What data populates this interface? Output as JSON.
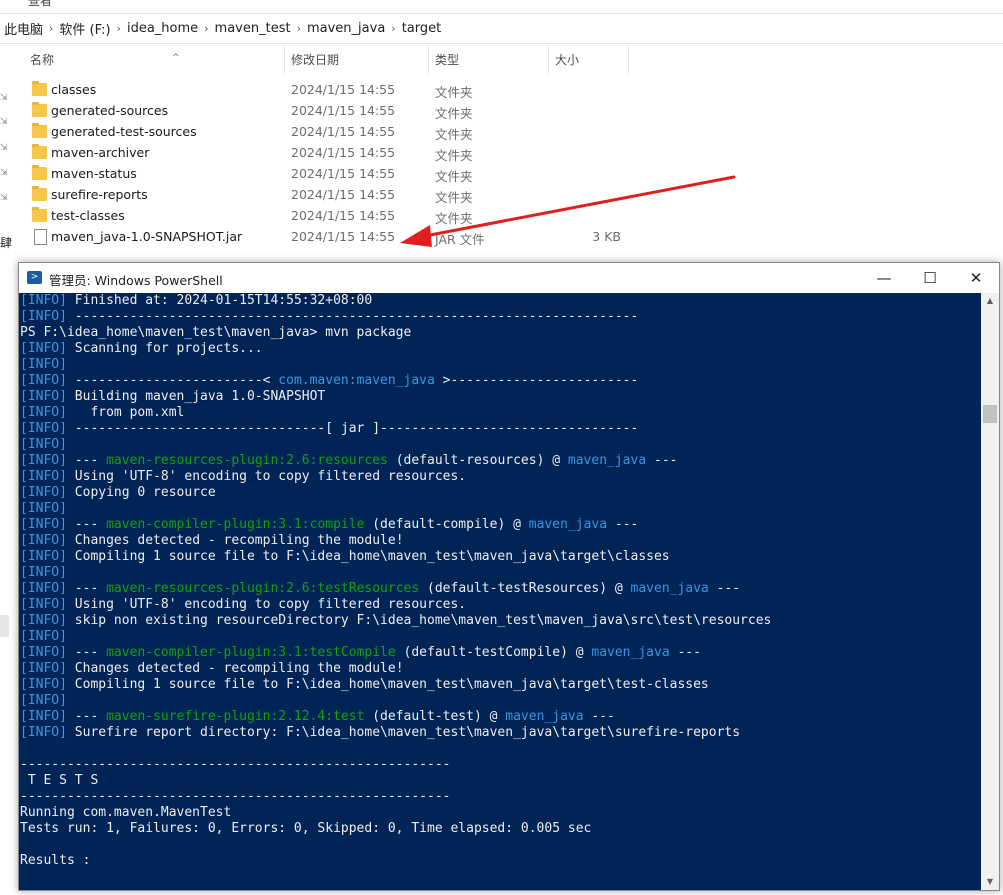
{
  "explorer": {
    "top_strip_text": "查看",
    "breadcrumbs": [
      "此电脑",
      "软件 (F:)",
      "idea_home",
      "maven_test",
      "maven_java",
      "target"
    ],
    "columns": {
      "name": "名称",
      "date": "修改日期",
      "type": "类型",
      "size": "大小"
    },
    "files": [
      {
        "name": "classes",
        "date": "2024/1/15 14:55",
        "type": "文件夹",
        "size": "",
        "icon": "folder-icon"
      },
      {
        "name": "generated-sources",
        "date": "2024/1/15 14:55",
        "type": "文件夹",
        "size": "",
        "icon": "folder-icon"
      },
      {
        "name": "generated-test-sources",
        "date": "2024/1/15 14:55",
        "type": "文件夹",
        "size": "",
        "icon": "folder-icon"
      },
      {
        "name": "maven-archiver",
        "date": "2024/1/15 14:55",
        "type": "文件夹",
        "size": "",
        "icon": "folder-icon"
      },
      {
        "name": "maven-status",
        "date": "2024/1/15 14:55",
        "type": "文件夹",
        "size": "",
        "icon": "folder-icon"
      },
      {
        "name": "surefire-reports",
        "date": "2024/1/15 14:55",
        "type": "文件夹",
        "size": "",
        "icon": "folder-icon"
      },
      {
        "name": "test-classes",
        "date": "2024/1/15 14:55",
        "type": "文件夹",
        "size": "",
        "icon": "folder-icon"
      },
      {
        "name": "maven_java-1.0-SNAPSHOT.jar",
        "date": "2024/1/15 14:55",
        "type": "JAR 文件",
        "size": "3 KB",
        "icon": "jar-file-icon"
      }
    ],
    "left_fragment": "肆"
  },
  "annotation": {
    "arrow_color": "#e02020"
  },
  "powershell": {
    "title": "管理员: Windows PowerShell",
    "icon_glyph": ">",
    "buttons": {
      "minimize": "—",
      "maximize": "☐",
      "close": "✕"
    },
    "colors": {
      "background": "#012456",
      "info_tag": "#3a96dd",
      "plugin": "#13a10e"
    },
    "lines": [
      [
        {
          "t": "[INFO]",
          "c": "tag"
        },
        {
          "t": " Finished at: 2024-01-15T14:55:32+08:00"
        }
      ],
      [
        {
          "t": "[INFO]",
          "c": "tag"
        },
        {
          "t": " ------------------------------------------------------------------------"
        }
      ],
      [
        {
          "t": "PS F:\\idea_home\\maven_test\\maven_java> mvn package"
        }
      ],
      [
        {
          "t": "[INFO]",
          "c": "tag"
        },
        {
          "t": " Scanning for projects..."
        }
      ],
      [
        {
          "t": "[INFO]",
          "c": "tag"
        }
      ],
      [
        {
          "t": "[INFO]",
          "c": "tag"
        },
        {
          "t": " ------------------------< "
        },
        {
          "t": "com.maven:maven_java",
          "c": "prj"
        },
        {
          "t": " >------------------------"
        }
      ],
      [
        {
          "t": "[INFO]",
          "c": "tag"
        },
        {
          "t": " Building maven_java 1.0-SNAPSHOT"
        }
      ],
      [
        {
          "t": "[INFO]",
          "c": "tag"
        },
        {
          "t": "   from pom.xml"
        }
      ],
      [
        {
          "t": "[INFO]",
          "c": "tag"
        },
        {
          "t": " --------------------------------[ jar ]---------------------------------"
        }
      ],
      [
        {
          "t": "[INFO]",
          "c": "tag"
        }
      ],
      [
        {
          "t": "[INFO]",
          "c": "tag"
        },
        {
          "t": " --- "
        },
        {
          "t": "maven-resources-plugin:2.6:resources",
          "c": "plg"
        },
        {
          "t": " (default-resources) @ "
        },
        {
          "t": "maven_java",
          "c": "prj"
        },
        {
          "t": " ---"
        }
      ],
      [
        {
          "t": "[INFO]",
          "c": "tag"
        },
        {
          "t": " Using 'UTF-8' encoding to copy filtered resources."
        }
      ],
      [
        {
          "t": "[INFO]",
          "c": "tag"
        },
        {
          "t": " Copying 0 resource"
        }
      ],
      [
        {
          "t": "[INFO]",
          "c": "tag"
        }
      ],
      [
        {
          "t": "[INFO]",
          "c": "tag"
        },
        {
          "t": " --- "
        },
        {
          "t": "maven-compiler-plugin:3.1:compile",
          "c": "plg"
        },
        {
          "t": " (default-compile) @ "
        },
        {
          "t": "maven_java",
          "c": "prj"
        },
        {
          "t": " ---"
        }
      ],
      [
        {
          "t": "[INFO]",
          "c": "tag"
        },
        {
          "t": " Changes detected - recompiling the module!"
        }
      ],
      [
        {
          "t": "[INFO]",
          "c": "tag"
        },
        {
          "t": " Compiling 1 source file to F:\\idea_home\\maven_test\\maven_java\\target\\classes"
        }
      ],
      [
        {
          "t": "[INFO]",
          "c": "tag"
        }
      ],
      [
        {
          "t": "[INFO]",
          "c": "tag"
        },
        {
          "t": " --- "
        },
        {
          "t": "maven-resources-plugin:2.6:testResources",
          "c": "plg"
        },
        {
          "t": " (default-testResources) @ "
        },
        {
          "t": "maven_java",
          "c": "prj"
        },
        {
          "t": " ---"
        }
      ],
      [
        {
          "t": "[INFO]",
          "c": "tag"
        },
        {
          "t": " Using 'UTF-8' encoding to copy filtered resources."
        }
      ],
      [
        {
          "t": "[INFO]",
          "c": "tag"
        },
        {
          "t": " skip non existing resourceDirectory F:\\idea_home\\maven_test\\maven_java\\src\\test\\resources"
        }
      ],
      [
        {
          "t": "[INFO]",
          "c": "tag"
        }
      ],
      [
        {
          "t": "[INFO]",
          "c": "tag"
        },
        {
          "t": " --- "
        },
        {
          "t": "maven-compiler-plugin:3.1:testCompile",
          "c": "plg"
        },
        {
          "t": " (default-testCompile) @ "
        },
        {
          "t": "maven_java",
          "c": "prj"
        },
        {
          "t": " ---"
        }
      ],
      [
        {
          "t": "[INFO]",
          "c": "tag"
        },
        {
          "t": " Changes detected - recompiling the module!"
        }
      ],
      [
        {
          "t": "[INFO]",
          "c": "tag"
        },
        {
          "t": " Compiling 1 source file to F:\\idea_home\\maven_test\\maven_java\\target\\test-classes"
        }
      ],
      [
        {
          "t": "[INFO]",
          "c": "tag"
        }
      ],
      [
        {
          "t": "[INFO]",
          "c": "tag"
        },
        {
          "t": " --- "
        },
        {
          "t": "maven-surefire-plugin:2.12.4:test",
          "c": "plg"
        },
        {
          "t": " (default-test) @ "
        },
        {
          "t": "maven_java",
          "c": "prj"
        },
        {
          "t": " ---"
        }
      ],
      [
        {
          "t": "[INFO]",
          "c": "tag"
        },
        {
          "t": " Surefire report directory: F:\\idea_home\\maven_test\\maven_java\\target\\surefire-reports"
        }
      ],
      [],
      [
        {
          "t": "-------------------------------------------------------"
        }
      ],
      [
        {
          "t": " T E S T S"
        }
      ],
      [
        {
          "t": "-------------------------------------------------------"
        }
      ],
      [
        {
          "t": "Running com.maven.MavenTest"
        }
      ],
      [
        {
          "t": "Tests run: 1, Failures: 0, Errors: 0, Skipped: 0, Time elapsed: 0.005 sec"
        }
      ],
      [],
      [
        {
          "t": "Results :"
        }
      ]
    ]
  }
}
